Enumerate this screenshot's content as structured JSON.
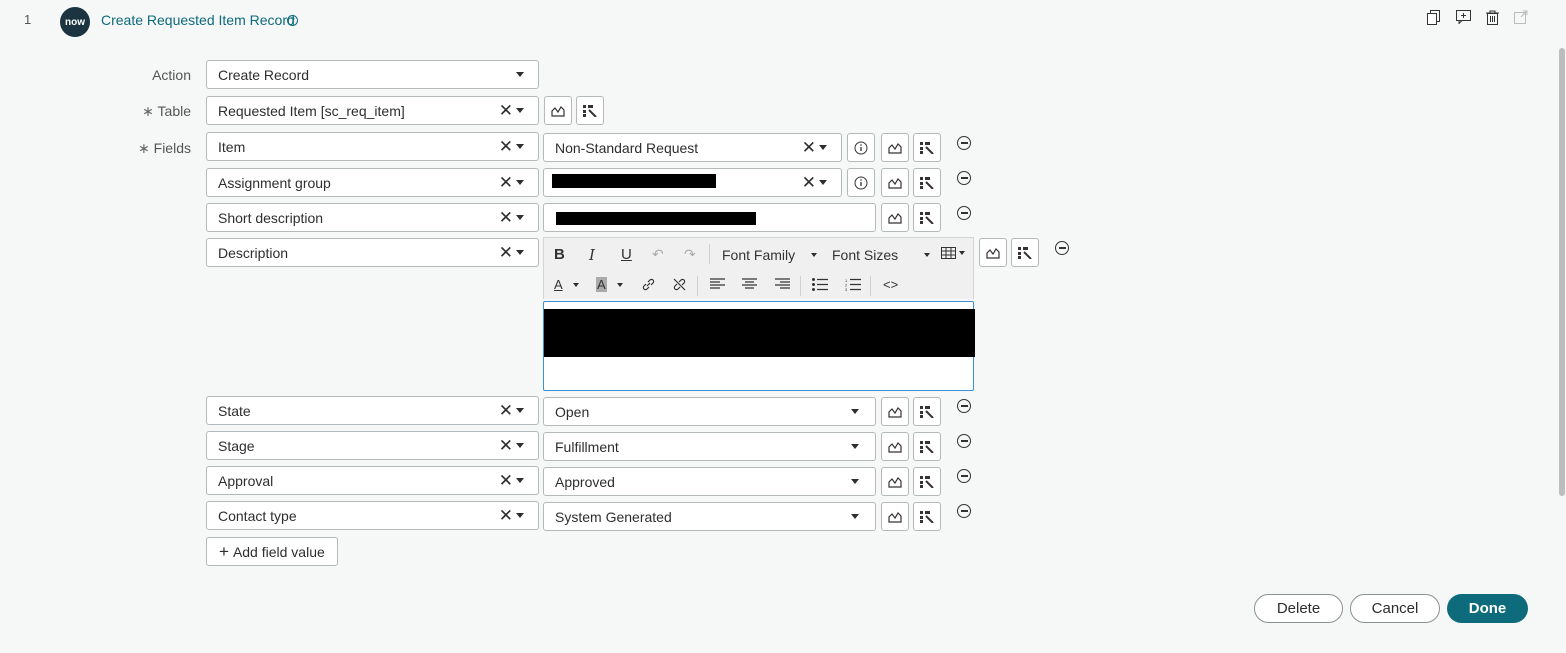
{
  "step": {
    "number": "1",
    "logo_text": "now",
    "title": "Create Requested Item Record"
  },
  "top_icons": [
    "copy-icon",
    "add-comment-icon",
    "trash-icon",
    "open-external-icon"
  ],
  "action": {
    "label": "Action",
    "value": "Create Record"
  },
  "table": {
    "label": "Table",
    "value": "Requested Item [sc_req_item]"
  },
  "fields_label": "Fields",
  "fields": [
    {
      "name": "Item",
      "value": "Non-Standard Request"
    },
    {
      "name": "Assignment group",
      "value": ""
    },
    {
      "name": "Short description",
      "value": ""
    },
    {
      "name": "Description",
      "value": ""
    },
    {
      "name": "State",
      "value": "Open"
    },
    {
      "name": "Stage",
      "value": "Fulfillment"
    },
    {
      "name": "Approval",
      "value": "Approved"
    },
    {
      "name": "Contact type",
      "value": "System Generated"
    }
  ],
  "editor": {
    "font_family": "Font Family",
    "font_sizes": "Font Sizes"
  },
  "add_field_label": "Add field value",
  "buttons": {
    "delete": "Delete",
    "cancel": "Cancel",
    "done": "Done"
  },
  "colors": {
    "accent": "#0d6b7c",
    "editor_focus": "#3a8fd6"
  }
}
